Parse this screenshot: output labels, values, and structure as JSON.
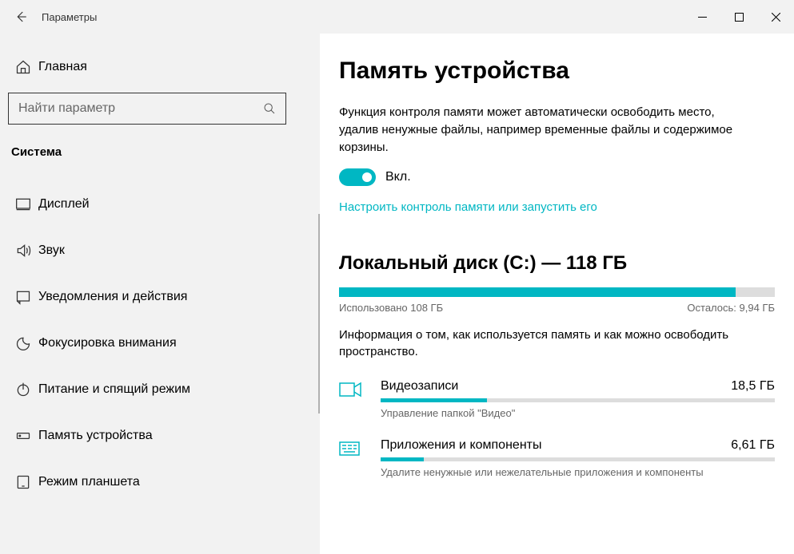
{
  "titlebar": {
    "title": "Параметры"
  },
  "sidebar": {
    "home": "Главная",
    "search_placeholder": "Найти параметр",
    "category": "Система",
    "items": [
      {
        "label": "Дисплей",
        "icon": "display"
      },
      {
        "label": "Звук",
        "icon": "sound"
      },
      {
        "label": "Уведомления и действия",
        "icon": "notifications"
      },
      {
        "label": "Фокусировка внимания",
        "icon": "focus"
      },
      {
        "label": "Питание и спящий режим",
        "icon": "power"
      },
      {
        "label": "Память устройства",
        "icon": "storage"
      },
      {
        "label": "Режим планшета",
        "icon": "tablet"
      }
    ]
  },
  "main": {
    "title": "Память устройства",
    "description": "Функция контроля памяти может автоматически освободить место, удалив ненужные файлы, например временные файлы и содержимое корзины.",
    "toggle_label": "Вкл.",
    "toggle_on": true,
    "link_configure": "Настроить контроль памяти или запустить его",
    "disk": {
      "title": "Локальный диск (C:) — 118 ГБ",
      "used_label": "Использовано 108 ГБ",
      "free_label": "Осталось: 9,94 ГБ",
      "fill_percent": 91
    },
    "info": "Информация о том, как используется память и как можно освободить пространство.",
    "categories": [
      {
        "name": "Видеозаписи",
        "size": "18,5 ГБ",
        "hint": "Управление папкой \"Видео\"",
        "percent": 27,
        "icon": "video"
      },
      {
        "name": "Приложения и компоненты",
        "size": "6,61 ГБ",
        "hint": "Удалите ненужные или нежелательные приложения и компоненты",
        "percent": 11,
        "icon": "apps"
      }
    ]
  }
}
